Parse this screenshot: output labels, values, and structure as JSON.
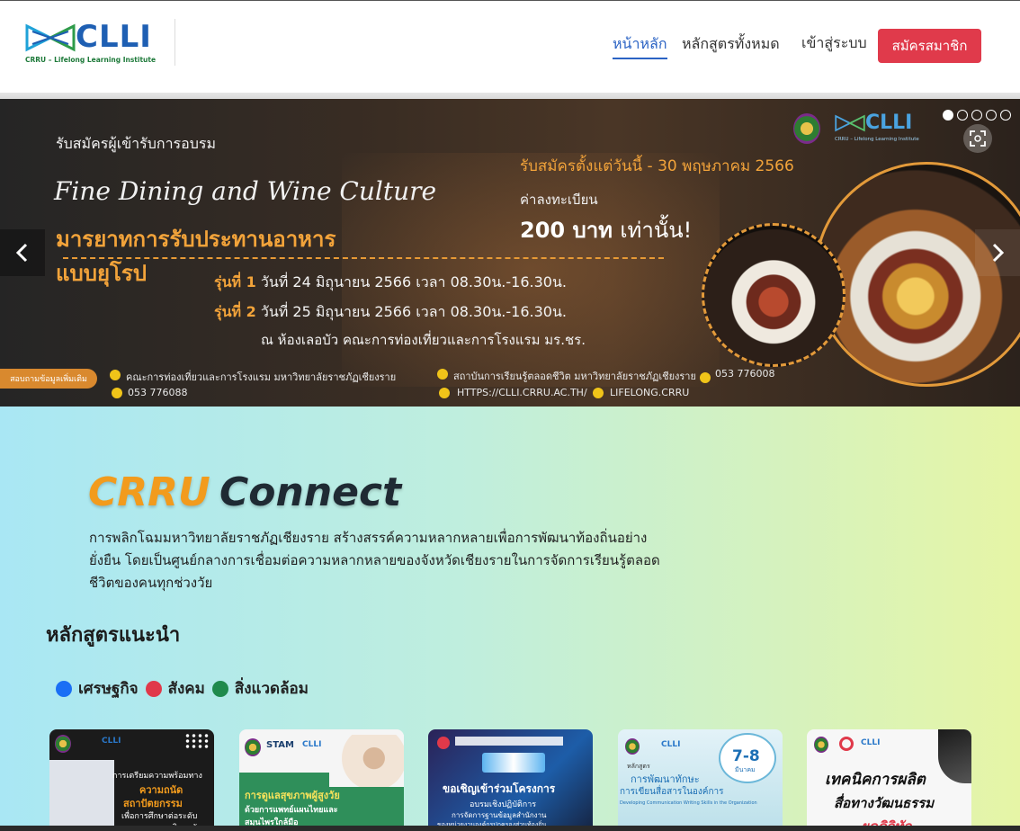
{
  "header": {
    "logo_word": "CLLI",
    "logo_subtitle": "CRRU – Lifelong Learning Institute",
    "nav": {
      "home": "หน้าหลัก",
      "courses": "หลักสูตรทั้งหมด",
      "login": "เข้าสู่ระบบ"
    },
    "signup_label": "สมัครสมาชิก",
    "colors": {
      "accent": "#2b63c4",
      "signup": "#e03a4b"
    }
  },
  "banner": {
    "apply_text": "รับสมัครผู้เข้ารับการอบรม",
    "script_title": "Fine Dining and Wine Culture",
    "main_title_1": "มารยาทการรับประทานอาหาร",
    "main_title_2": "แบบยุโรป",
    "open_period": "รับสมัครตั้งแต่วันนี้ - 30 พฤษภาคม 2566",
    "fee_label": "ค่าลงทะเบียน",
    "fee_amount": "200 บาท",
    "fee_suffix": "เท่านั้น!",
    "round1_label": "รุ่นที่ 1",
    "round1_text": "วันที่ 24 มิถุนายน 2566  เวลา 08.30น.-16.30น.",
    "round2_label": "รุ่นที่ 2",
    "round2_text": "วันที่ 25 มิถุนายน 2566 เวลา 08.30น.-16.30น.",
    "venue": "ณ ห้องเลอบัว คณะการท่องเที่ยวและการโรงแรม  มร.ชร.",
    "more_info": "สอบถามข้อมูลเพิ่มเติม",
    "contact_1": "คณะการท่องเที่ยวและการโรงแรม มหาวิทยาลัยราชภัฏเชียงราย",
    "contact_1_phone": "053 776088",
    "contact_2": "สถาบันการเรียนรู้ตลอดชีวิต มหาวิทยาลัยราชภัฏเชียงราย",
    "contact_2_phone": "053 776008",
    "website": "HTTPS://CLLI.CRRU.AC.TH/",
    "line_id": "LIFELONG.CRRU",
    "hero_logo_word": "CLLI",
    "hero_logo_sub": "CRRU – Lifelong Learning Institute",
    "slides_total": 5,
    "active_slide": 1
  },
  "connect": {
    "brand_part1": "CRRU",
    "brand_part2": "Connect",
    "intro": "การพลิกโฉมมหาวิทยาลัยราชภัฏเชียงราย สร้างสรรค์ความหลากหลายเพื่อการพัฒนาท้องถิ่นอย่างยั่งยืน โดยเป็นศูนย์กลางการเชื่อมต่อความหลากหลายของจังหวัดเชียงรายในการจัดการเรียนรู้ตลอดชีวิตของคนทุกช่วงวัย",
    "recommended_title": "หลักสูตรแนะนำ",
    "legend": [
      {
        "label": "เศรษฐกิจ",
        "color": "#1a6ff5"
      },
      {
        "label": "สังคม",
        "color": "#e0394a"
      },
      {
        "label": "สิ่งแวดล้อม",
        "color": "#1f8a4c"
      }
    ]
  },
  "courses": [
    {
      "line1": "การเตรียมความพร้อมทาง",
      "line2": "ความถนัด",
      "line3": "สถาปัตยกรรม",
      "line4": "เพื่อการศึกษาต่อระดับ",
      "line5": "มหาวิทยาลัย"
    },
    {
      "badge": "STAM",
      "line1": "การดูแลสุขภาพผู้สูงวัย",
      "line2": "ด้วยการแพทย์แผนไทยและ",
      "line3": "สมุนไพรใกล้มือ"
    },
    {
      "line1": "ขอเชิญเข้าร่วมโครงการ",
      "line2": "อบรมเชิงปฏิบัติการ",
      "line3": "การจัดการฐานข้อมูลสำนักงาน",
      "line4": "ของหน่วยงานองค์กรปกครองส่วนท้องถิ่น"
    },
    {
      "date_badge": "7-8",
      "month": "มีนาคม",
      "line1": "หลักสูตร",
      "line2": "การพัฒนาทักษะ",
      "line3": "การเขียนสื่อสารในองค์การ",
      "line4": "Developing Communication Writing Skills in the Organization"
    },
    {
      "line1": "เทคนิคการผลิต",
      "line2": "สื่อทางวัฒนธรรม",
      "line3": "ยุคดิจิทัล"
    }
  ]
}
